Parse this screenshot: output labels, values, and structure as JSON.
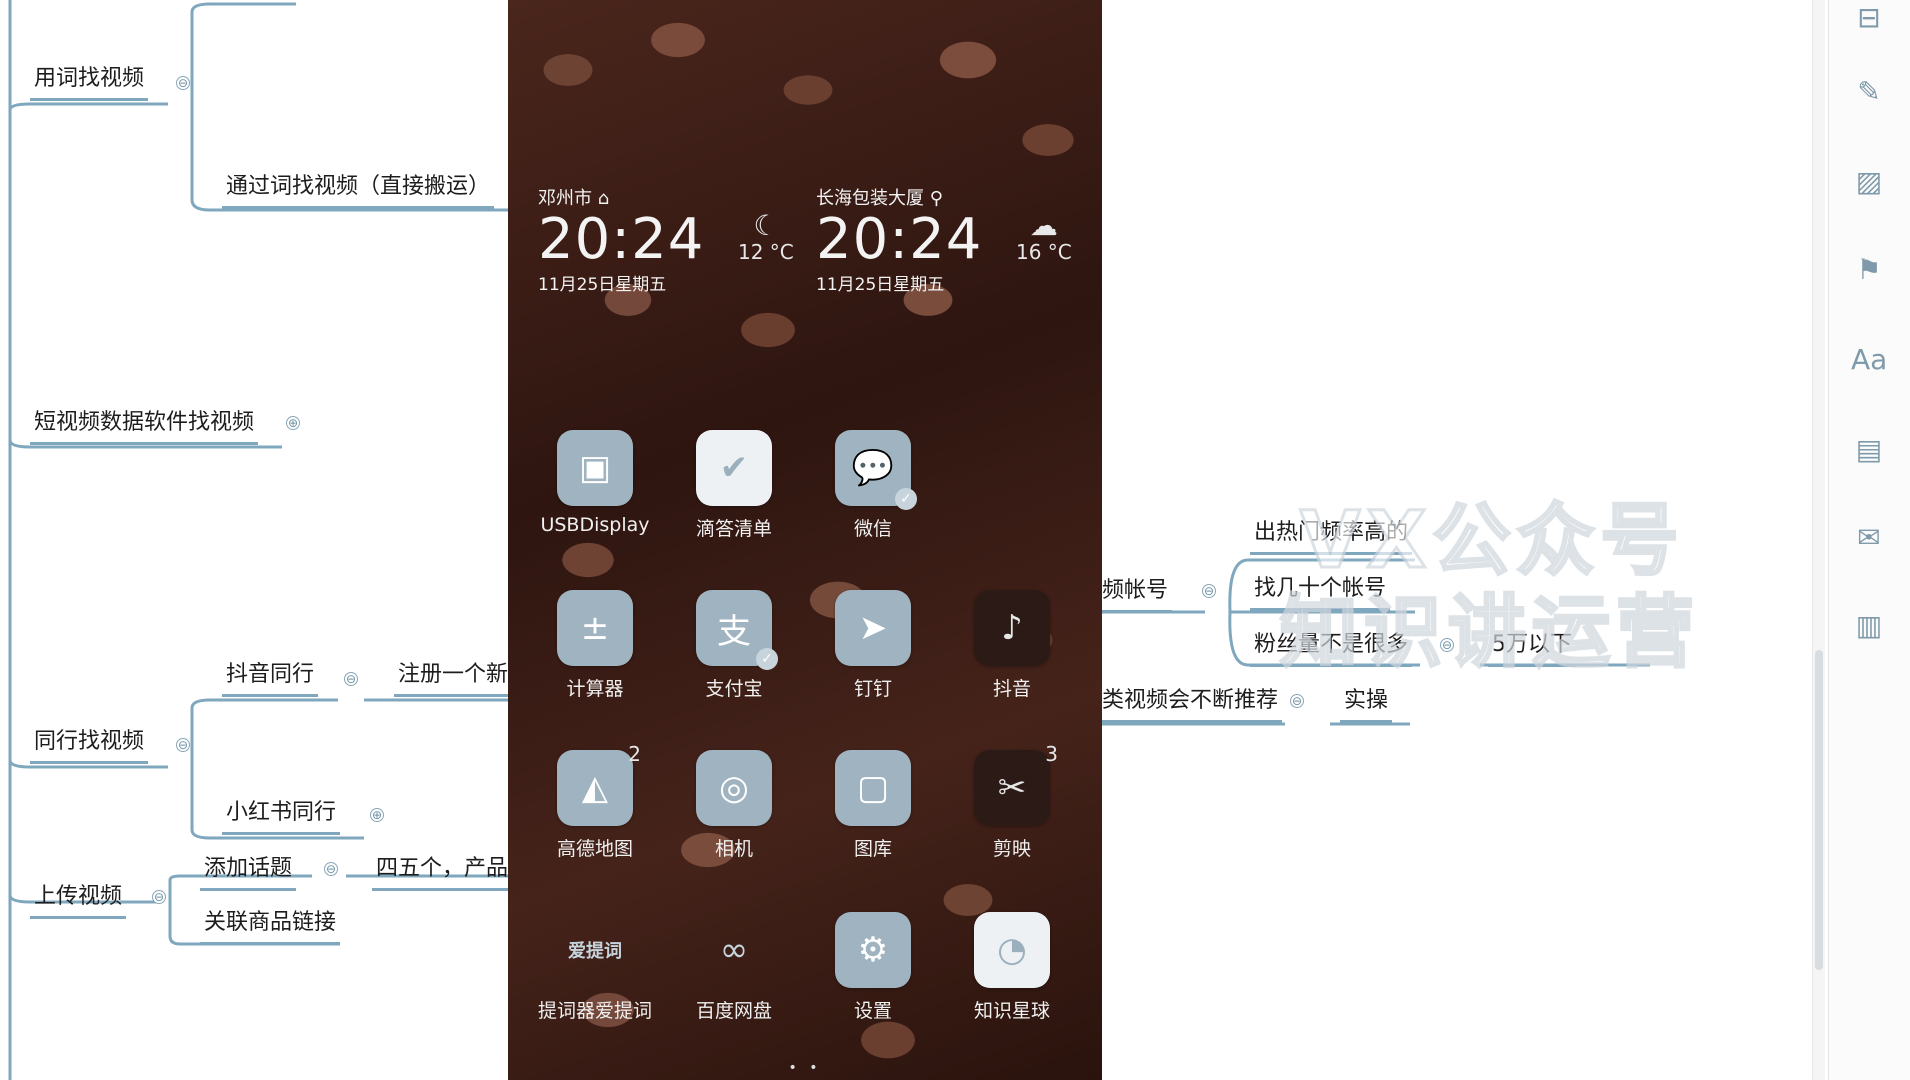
{
  "mindmap": {
    "left_nodes": {
      "find_by_words": "用词找视频",
      "via_words": "通过词找视频（直接搬运）",
      "data_software": "短视频数据软件找视频",
      "peer": "同行找视频",
      "douyin_peer": "抖音同行",
      "register_new": "注册一个新",
      "xiaohongshu_peer": "小红书同行",
      "upload": "上传视频",
      "add_topic": "添加话题",
      "four_five": "四五个，产品",
      "link_product": "关联商品链接"
    },
    "right_nodes": {
      "video_account": "频帐号",
      "hot_rate": "出热门频率高的",
      "find_accounts": "找几十个帐号",
      "fans_not_many": "粉丝量不是很多",
      "under_50k": "5万以下",
      "keep_recommend": "类视频会不断推荐",
      "practice": "实操"
    },
    "toggle_minus": "⊖",
    "toggle_plus": "⊕",
    "watermark_line1": "VX公众号",
    "watermark_line2": "知识讲运营"
  },
  "phone": {
    "clock1": {
      "city": "邓州市",
      "time": "20:24",
      "date": "11月25日星期五",
      "temp": "12 °C",
      "weather_icon": "moon-icon"
    },
    "clock2": {
      "city": "长海包装大厦",
      "time": "20:24",
      "date": "11月25日星期五",
      "temp": "16 °C",
      "weather_icon": "cloud-moon-icon"
    },
    "apps": [
      {
        "label": "USBDisplay",
        "icon": "usb-display-icon"
      },
      {
        "label": "滴答清单",
        "icon": "check-icon"
      },
      {
        "label": "微信",
        "icon": "wechat-icon",
        "badge": "2"
      },
      {
        "label": "计算器",
        "icon": "calculator-icon"
      },
      {
        "label": "支付宝",
        "icon": "alipay-icon"
      },
      {
        "label": "钉钉",
        "icon": "dingtalk-icon"
      },
      {
        "label": "抖音",
        "icon": "tiktok-icon"
      },
      {
        "label": "高德地图",
        "icon": "map-icon",
        "badge": "2"
      },
      {
        "label": "相机",
        "icon": "camera-icon"
      },
      {
        "label": "图库",
        "icon": "gallery-icon"
      },
      {
        "label": "剪映",
        "icon": "capcut-icon",
        "badge": "3"
      },
      {
        "label": "提词器爱提词",
        "icon": "teleprompter-icon",
        "icon_text": "爱提词"
      },
      {
        "label": "百度网盘",
        "icon": "cloud-drive-icon"
      },
      {
        "label": "设置",
        "icon": "settings-icon"
      },
      {
        "label": "知识星球",
        "icon": "planet-icon"
      }
    ]
  },
  "toolbar": [
    "layout-icon",
    "brush-icon",
    "image-icon",
    "flag-icon",
    "text-style-icon",
    "document-icon",
    "comment-icon",
    "clipboard-icon"
  ]
}
